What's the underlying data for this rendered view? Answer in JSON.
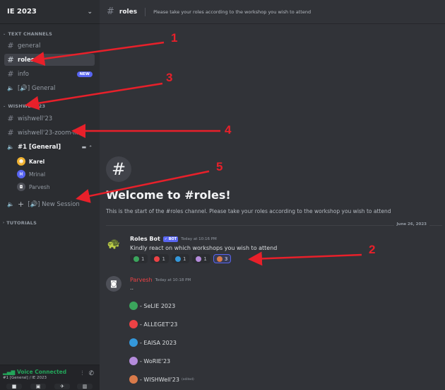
{
  "server": {
    "name": "IE 2023"
  },
  "categories": {
    "text_channels": "TEXT CHANNELS",
    "wishwell": "WISHWELL'23",
    "tutorials": "TUTORIALS"
  },
  "channels": {
    "general": "general",
    "roles": "roles",
    "info": "info",
    "info_badge": "NEW",
    "voice_general": "[🔊] General",
    "wishwell": "wishwell'23",
    "zoom_link": "wishwell'23-zoom-link",
    "voice_stage": "#1 [General]",
    "new_session": "[🔊] New Session"
  },
  "voice_users": [
    {
      "name": "Karel",
      "color": "#f0b232"
    },
    {
      "name": "Mrinal",
      "color": "#5865f2"
    },
    {
      "name": "Parvesh",
      "color": "#4e5058"
    }
  ],
  "voice_bar": {
    "status": "Voice Connected",
    "sub": "#1 [General] / IE 2023"
  },
  "topbar": {
    "channel": "roles",
    "topic": "Please take your roles according to the workshop you wish to attend"
  },
  "welcome": {
    "title": "Welcome to #roles!",
    "subtitle": "This is the start of the #roles channel. Please take your roles according to the workshop you wish to attend"
  },
  "date_divider": "June 26, 2023",
  "messages": {
    "bot": {
      "author": "Roles Bot",
      "tag": "✓ BOT",
      "time": "Today at 10:16 PM",
      "text": "Kindly react on which workshops you wish to attend",
      "reactions": [
        {
          "color": "#3ba55c",
          "count": "1"
        },
        {
          "color": "#ed4245",
          "count": "1"
        },
        {
          "color": "#3498db",
          "count": "1"
        },
        {
          "color": "#b48bdb",
          "count": "1"
        },
        {
          "color": "#d97a4a",
          "count": "3",
          "mine": true
        }
      ]
    },
    "user": {
      "author": "Parvesh",
      "author_color": "#ed4245",
      "time": "Today at 10:18 PM",
      "text": "..",
      "roles": [
        {
          "color": "#3ba55c",
          "label": "- SeLIE 2023"
        },
        {
          "color": "#ed4245",
          "label": "- ALLEGET'23"
        },
        {
          "color": "#3498db",
          "label": "- EAISA 2023"
        },
        {
          "color": "#b48bdb",
          "label": "- WoRIE'23"
        },
        {
          "color": "#d97a4a",
          "label": "- WISHWell'23",
          "edited": "(edited)"
        }
      ]
    }
  },
  "annotations": [
    "1",
    "2",
    "3",
    "4",
    "5"
  ]
}
